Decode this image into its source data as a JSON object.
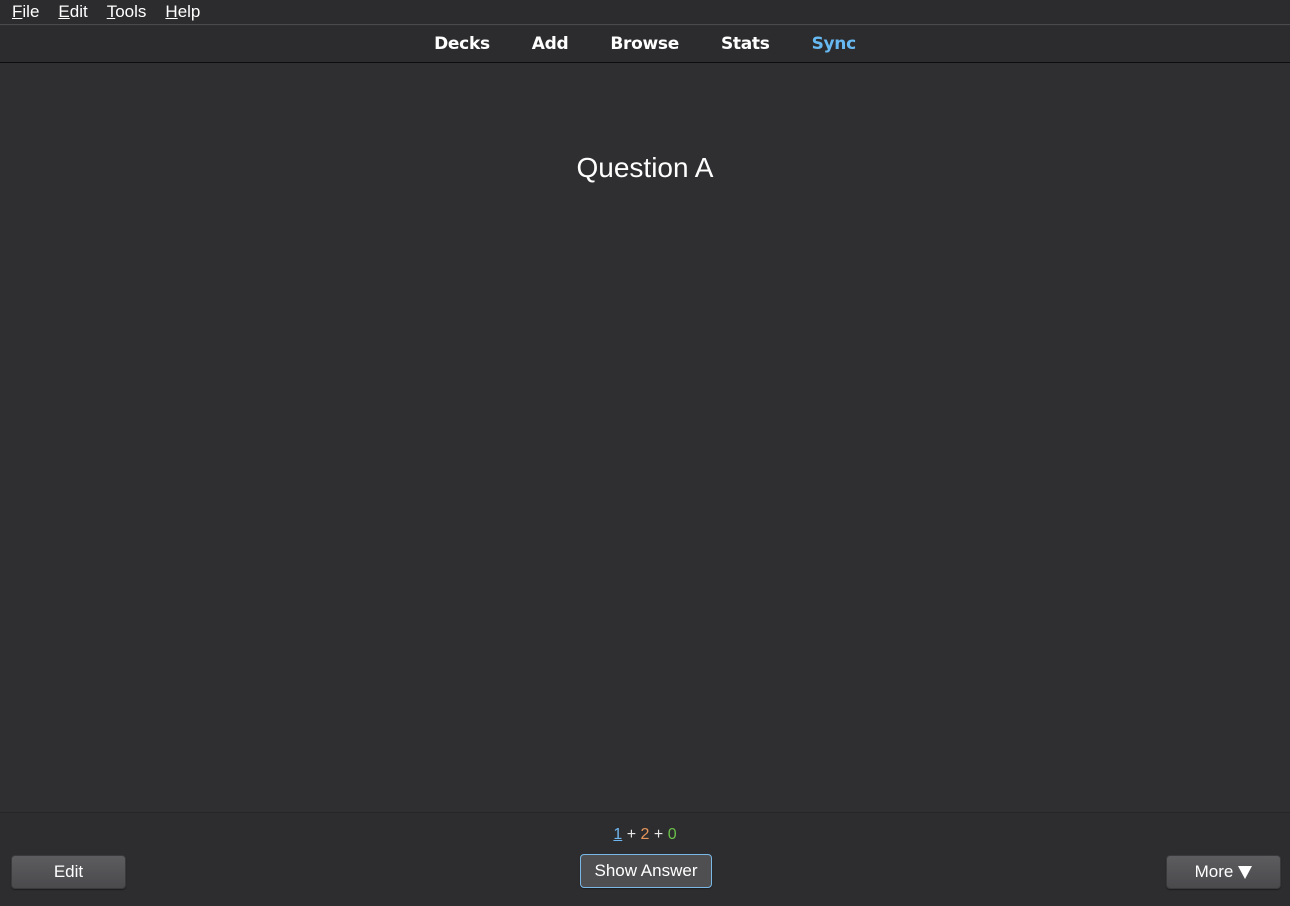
{
  "menu": {
    "items": [
      {
        "underline": "F",
        "rest": "ile"
      },
      {
        "underline": "E",
        "rest": "dit"
      },
      {
        "underline": "T",
        "rest": "ools"
      },
      {
        "underline": "H",
        "rest": "elp"
      }
    ]
  },
  "toolbar": {
    "links": [
      "Decks",
      "Add",
      "Browse",
      "Stats",
      "Sync"
    ],
    "sync_color": "#67b9f2"
  },
  "card": {
    "question": "Question A"
  },
  "counts": {
    "new": "1",
    "learning": "2",
    "review": "0",
    "separator": "+",
    "colors": {
      "new": "#6fb6f0",
      "learning": "#e8965a",
      "review": "#6cc04a"
    }
  },
  "buttons": {
    "edit": "Edit",
    "show_answer": "Show Answer",
    "more": "More",
    "more_icon": "triangle-down-icon"
  }
}
